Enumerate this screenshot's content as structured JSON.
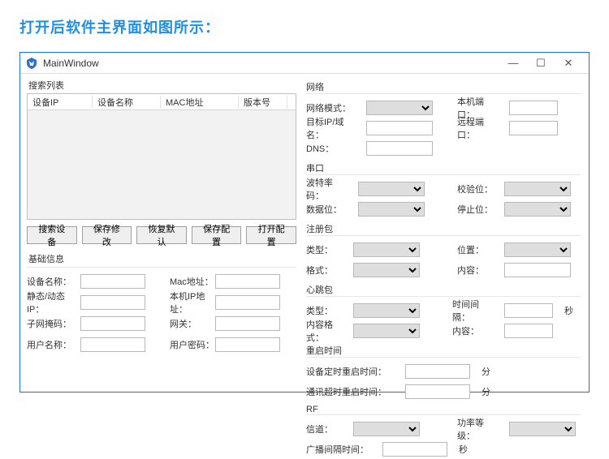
{
  "caption": "打开后软件主界面如图所示：",
  "window": {
    "title": "MainWindow",
    "search_panel_title": "搜索列表",
    "columns": {
      "ip": "设备IP",
      "name": "设备名称",
      "mac": "MAC地址",
      "ver": "版本号"
    },
    "buttons": {
      "search": "搜索设备",
      "save": "保存修改",
      "restore": "恢复默认",
      "savecfg": "保存配置",
      "opencfg": "打开配置"
    },
    "basic_info": {
      "title": "基础信息",
      "device_name": "设备名称：",
      "mac": "Mac地址：",
      "static_ip": "静态/动态IP：",
      "local_ip": "本机IP地址：",
      "subnet": "子网掩码：",
      "gateway": "网关：",
      "user": "用户名称：",
      "pwd": "用户密码："
    },
    "network": {
      "title": "网络",
      "net_mode": "网络模式：",
      "local_port": "本机端口：",
      "target": "目标IP/域名：",
      "remote_port": "远程端口：",
      "dns": "DNS："
    },
    "serial": {
      "title": "串口",
      "baud": "波特率码：",
      "parity": "校验位：",
      "data": "数据位：",
      "stop": "停止位："
    },
    "register": {
      "title": "注册包",
      "type": "类型：",
      "position": "位置：",
      "format": "格式：",
      "content": "内容："
    },
    "heartbeat": {
      "title": "心跳包",
      "type": "类型：",
      "interval": "时间间隔：",
      "format": "内容格式：",
      "content": "内容：",
      "unit_sec": "秒"
    },
    "reboot": {
      "title": "重启时间",
      "dev_label": "设备定时重启时间：",
      "comm_label": "通讯超时重启时间：",
      "unit_min": "分"
    },
    "rf": {
      "title": "RF",
      "channel": "信道：",
      "power": "功率等级：",
      "broadcast": "广播间隔时间：",
      "unit_sec": "秒"
    }
  }
}
